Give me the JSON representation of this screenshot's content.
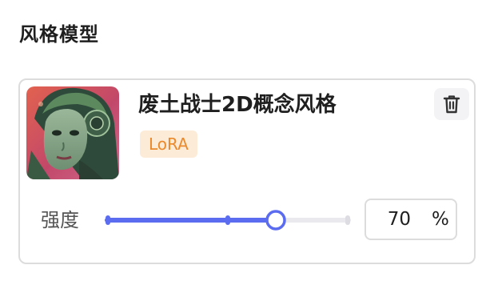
{
  "section": {
    "title": "风格模型"
  },
  "model": {
    "name": "废土战士2D概念风格",
    "tag": "LoRA",
    "thumbnail_icon": "cyberpunk-warrior-portrait"
  },
  "strength": {
    "label": "强度",
    "value": "70",
    "unit": "%",
    "fraction": 0.7,
    "marks": [
      0,
      0.5,
      1
    ]
  },
  "icons": {
    "delete": "trash-icon"
  },
  "colors": {
    "accent": "#5b6cf0",
    "track": "#e9e9ee",
    "tag_bg": "#fcebd7",
    "tag_text": "#ea8a2c",
    "border": "#dcdcdc"
  }
}
